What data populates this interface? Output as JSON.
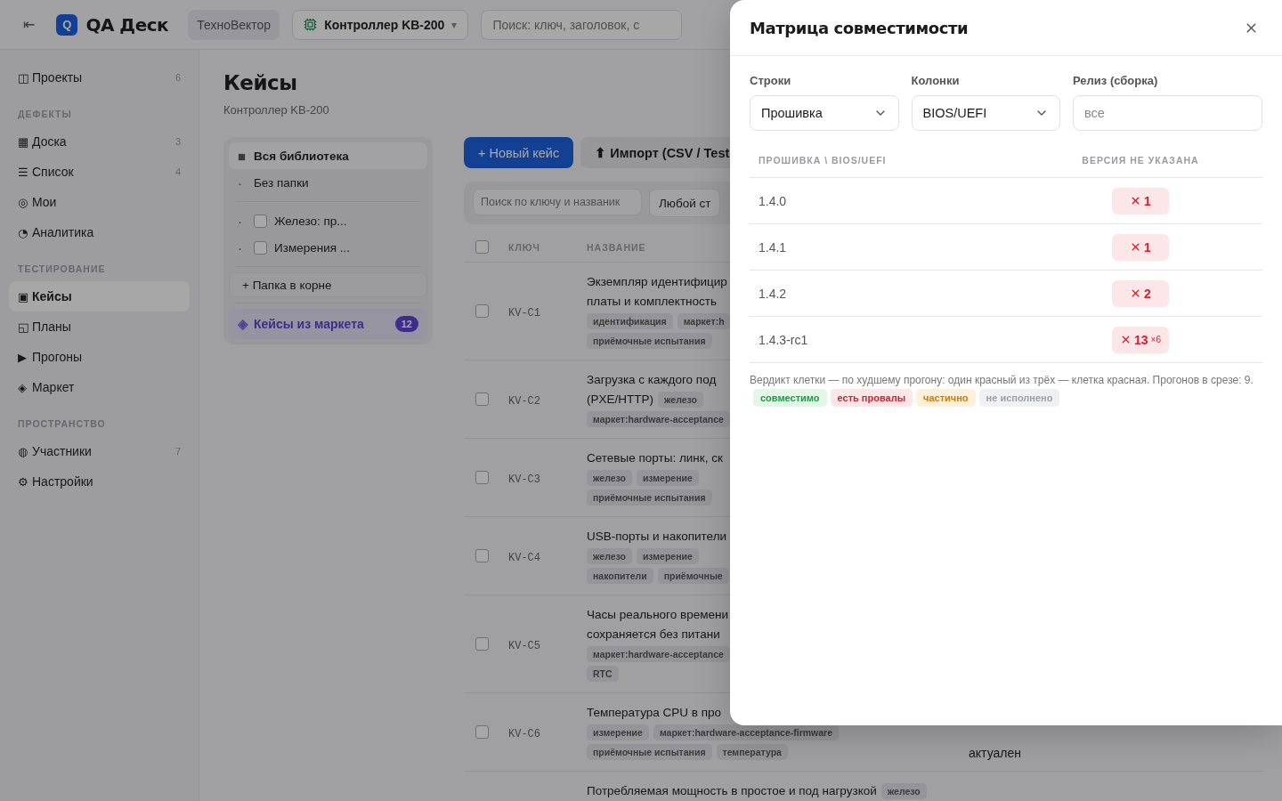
{
  "header": {
    "collapse": "⇤",
    "logo_letter": "Q",
    "app_name": "QA Деск",
    "workspace": "ТехноВектор",
    "project": {
      "label": "Контроллер KB-200",
      "caret": "▾"
    },
    "search": {
      "placeholder": "Поиск: ключ, заголовок, с"
    }
  },
  "sidebar": {
    "groups": [
      {
        "items": [
          {
            "icon": "◫",
            "label": "Проекты",
            "count": "6",
            "selected": false
          }
        ]
      },
      {
        "title": "ДЕФЕКТЫ",
        "items": [
          {
            "icon": "▦",
            "label": "Доска",
            "count": "3",
            "selected": false
          },
          {
            "icon": "☰",
            "label": "Список",
            "count": "4",
            "selected": false
          },
          {
            "icon": "◎",
            "label": "Мои",
            "selected": false
          },
          {
            "icon": "◔",
            "label": "Аналитика",
            "selected": false
          }
        ]
      },
      {
        "title": "ТЕСТИРОВАНИЕ",
        "items": [
          {
            "icon": "▣",
            "label": "Кейсы",
            "selected": true
          },
          {
            "icon": "◱",
            "label": "Планы",
            "selected": false
          },
          {
            "icon": "▶",
            "label": "Прогоны",
            "selected": false
          },
          {
            "icon": "◈",
            "label": "Маркет",
            "selected": false
          }
        ]
      },
      {
        "title": "ПРОСТРАНСТВО",
        "items": [
          {
            "icon": "◍",
            "label": "Участники",
            "count": "7",
            "selected": false
          },
          {
            "icon": "⚙",
            "label": "Настройки",
            "selected": false
          }
        ]
      }
    ]
  },
  "page": {
    "title": "Кейсы",
    "subtitle": "Контроллер KB-200"
  },
  "folders": {
    "items": [
      {
        "kind": "root",
        "icon": "■",
        "label": "Вся библиотека",
        "selected": true
      },
      {
        "kind": "root",
        "icon": "·",
        "label": "Без папки",
        "selected": false
      },
      {
        "kind": "folder",
        "icon": "·",
        "label": "Железо: пр...",
        "checked": false
      },
      {
        "kind": "folder",
        "icon": "·",
        "label": "Измерения ...",
        "checked": false
      }
    ],
    "add_button": "+ Папка в корне",
    "market": {
      "icon": "◈",
      "label": "Кейсы из маркета",
      "badge": "12"
    }
  },
  "toolbar": {
    "buttons": [
      {
        "kind": "primary",
        "label": "+ Новый кейс"
      },
      {
        "kind": "secondary",
        "label": "⬆ Импорт (CSV / Test"
      }
    ]
  },
  "filters": {
    "search": {
      "placeholder": "Поиск по ключу и названик"
    },
    "status": "Любой ст"
  },
  "table": {
    "columns": [
      "КЛЮЧ",
      "НАЗВАНИЕ"
    ],
    "header_checked": false,
    "rows": [
      {
        "key": "KV-C1",
        "checked": false,
        "lines": [
          [
            {
              "kind": "title",
              "text": "Экземпляр идентифицир"
            }
          ],
          [
            {
              "kind": "title",
              "text": "платы и комплектность"
            }
          ],
          [
            {
              "kind": "tag",
              "text": "идентификация"
            },
            {
              "kind": "tag",
              "text": "маркет:h"
            }
          ],
          [
            {
              "kind": "tag",
              "text": "приёмочные испытания"
            }
          ]
        ]
      },
      {
        "key": "KV-C2",
        "checked": false,
        "lines": [
          [
            {
              "kind": "title",
              "text": "Загрузка с каждого под"
            }
          ],
          [
            {
              "kind": "title",
              "text": "(PXE/HTTP)"
            },
            {
              "kind": "tag",
              "text": "железо"
            }
          ],
          [
            {
              "kind": "tag",
              "text": "маркет:hardware-acceptance"
            }
          ]
        ]
      },
      {
        "key": "KV-C3",
        "checked": false,
        "lines": [
          [
            {
              "kind": "title",
              "text": "Сетевые порты: линк, ск"
            }
          ],
          [
            {
              "kind": "tag",
              "text": "железо"
            },
            {
              "kind": "tag",
              "text": "измерение"
            }
          ],
          [
            {
              "kind": "tag",
              "text": "приёмочные испытания"
            }
          ]
        ]
      },
      {
        "key": "KV-C4",
        "checked": false,
        "lines": [
          [
            {
              "kind": "title",
              "text": "USB-порты и накопители"
            }
          ],
          [
            {
              "kind": "tag",
              "text": "железо"
            },
            {
              "kind": "tag",
              "text": "измерение"
            }
          ],
          [
            {
              "kind": "tag",
              "text": "накопители"
            },
            {
              "kind": "tag",
              "text": "приёмочные"
            }
          ]
        ]
      },
      {
        "key": "KV-C5",
        "checked": false,
        "lines": [
          [
            {
              "kind": "title",
              "text": "Часы реального времени"
            }
          ],
          [
            {
              "kind": "title",
              "text": "сохраняется без питани"
            }
          ],
          [
            {
              "kind": "tag",
              "text": "маркет:hardware-acceptance"
            }
          ],
          [
            {
              "kind": "tag",
              "text": "RTC"
            }
          ]
        ]
      },
      {
        "key": "KV-C6",
        "checked": false,
        "status": "актуален",
        "lines": [
          [
            {
              "kind": "title",
              "text": "Температура CPU в про"
            }
          ],
          [
            {
              "kind": "tag",
              "text": "измерение"
            },
            {
              "kind": "tag",
              "text": "маркет:hardware-acceptance-firmware"
            }
          ],
          [
            {
              "kind": "tag",
              "text": "приёмочные испытания"
            },
            {
              "kind": "tag",
              "text": "температура"
            }
          ]
        ]
      },
      {
        "lines": [
          [
            {
              "kind": "title",
              "text": "Потребляемая мощность в простое и под нагрузкой"
            },
            {
              "kind": "tag",
              "text": "железо"
            }
          ]
        ]
      }
    ]
  },
  "modal": {
    "title": "Матрица совместимости",
    "fields": [
      {
        "kind": "select",
        "label": "Строки",
        "value": "Прошивка"
      },
      {
        "kind": "select",
        "label": "Колонки",
        "value": "BIOS/UEFI"
      },
      {
        "kind": "input",
        "label": "Релиз (сборка)",
        "placeholder": "все"
      }
    ],
    "matrix": {
      "columns": [
        "ПРОШИВКА \\ BIOS/UEFI",
        "ВЕРСИЯ НЕ УКАЗАНА"
      ],
      "rows": [
        {
          "label": "1.4.0",
          "cell": {
            "kind": "fail",
            "count": "1"
          }
        },
        {
          "label": "1.4.1",
          "cell": {
            "kind": "fail",
            "count": "1"
          }
        },
        {
          "label": "1.4.2",
          "cell": {
            "kind": "fail",
            "count": "2"
          }
        },
        {
          "label": "1.4.3-rc1",
          "cell": {
            "kind": "fail",
            "count": "13",
            "extra": "×6"
          }
        }
      ]
    },
    "note": "Вердикт клетки — по худшему прогону: один красный из трёх — клетка красная. Прогонов в срезе: 9.",
    "legend": [
      {
        "kind": "ok",
        "label": "совместимо"
      },
      {
        "kind": "fail",
        "label": "есть провалы"
      },
      {
        "kind": "partial",
        "label": "частично"
      },
      {
        "kind": "notrun",
        "label": "не исполнено"
      }
    ]
  }
}
